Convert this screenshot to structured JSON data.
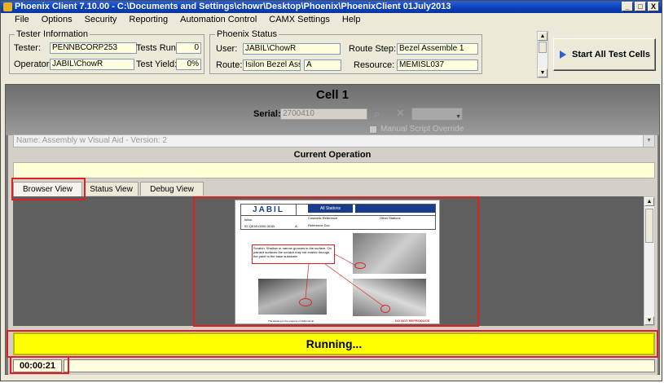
{
  "window": {
    "title": "Phoenix Client 7.10.00 - C:\\Documents and Settings\\chowr\\Desktop\\Phoenix\\PhoenixClient 01July2013",
    "minimize": "_",
    "maximize": "□",
    "close": "X"
  },
  "menu": [
    "File",
    "Options",
    "Security",
    "Reporting",
    "Automation Control",
    "CAMX Settings",
    "Help"
  ],
  "tester_info": {
    "legend": "Tester Information",
    "tester_label": "Tester:",
    "tester_value": "PENNBCORP253",
    "tests_run_label": "Tests Run:",
    "tests_run_value": "0",
    "operator_label": "Operator:",
    "operator_value": "JABIL\\ChowR",
    "test_yield_label": "Test Yield:",
    "test_yield_value": "0%"
  },
  "phoenix_status": {
    "legend": "Phoenix Status",
    "user_label": "User:",
    "user_value": "JABIL\\ChowR",
    "route_label": "Route:",
    "route_value": "Isilon Bezel Asse",
    "route_rev": "A",
    "route_step_label": "Route Step:",
    "route_step_value": "Bezel Assemble 1",
    "resource_label": "Resource:",
    "resource_value": "MEMISL037"
  },
  "start_button": "Start All Test Cells",
  "cell": {
    "title": "Cell 1",
    "serial_label": "Serial:",
    "serial_value": "2700410",
    "manual_override_label": "Manual Script Override",
    "script_name": "Name: Assembly w Visual Aid - Version: 2",
    "current_operation_label": "Current Operation",
    "tabs": [
      "Browser View",
      "Status View",
      "Debug View"
    ],
    "status_text": "Running...",
    "timer": "00:00:21"
  },
  "document": {
    "logo": "JABIL",
    "header_cells": [
      "All Stations",
      "Isilon",
      "Cosmetic Reference",
      "Other Stations",
      "Reference Doc",
      "A"
    ],
    "part_number": "02-QE40-0000-001B",
    "callout_text": "Scratch: Shallow or narrow grooves in the surface. On painted surfaces the scratch may not extend through the paint to the base substrate.",
    "footer": "The drawing is the property of Jabil Circuit",
    "footer_warning": "DO NOT REPRODUCE"
  },
  "colors": {
    "status_bg": "#ffff00",
    "highlight_red": "#e02020",
    "title_blue": "#0a3fb8"
  }
}
